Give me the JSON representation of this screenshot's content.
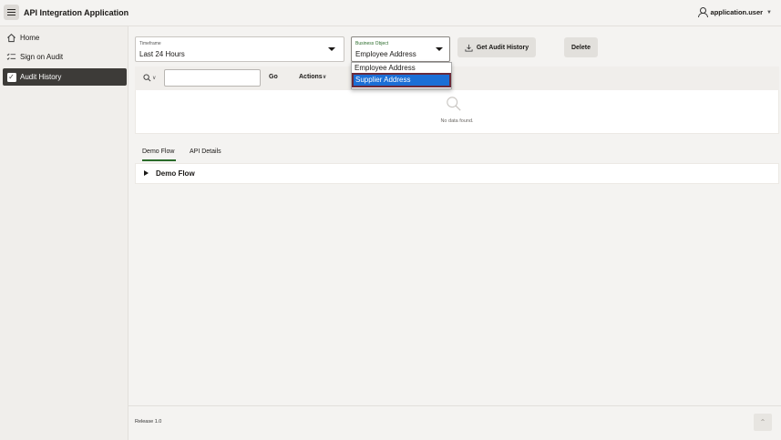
{
  "header": {
    "app_title": "API Integration Application",
    "user_name": "application.user",
    "menu_icon": "hamburger-icon",
    "user_icon": "user-icon"
  },
  "sidebar": {
    "items": [
      {
        "label": "Home",
        "icon": "home-icon",
        "active": false
      },
      {
        "label": "Sign on Audit",
        "icon": "checklist-icon",
        "active": false
      },
      {
        "label": "Audit History",
        "icon": "checkbox-icon",
        "active": true
      }
    ]
  },
  "filters": {
    "timeframe": {
      "label": "Timeframe",
      "value": "Last 24 Hours"
    },
    "business_object": {
      "label": "Business Object",
      "value": "Employee Address",
      "options": [
        "Employee Address",
        "Supplier Address"
      ],
      "highlighted": "Supplier Address"
    }
  },
  "buttons": {
    "get_audit_history": "Get Audit History",
    "delete": "Delete"
  },
  "report": {
    "go_label": "Go",
    "actions_label": "Actions",
    "no_data": "No data found."
  },
  "tabs": [
    {
      "label": "Demo Flow",
      "active": true
    },
    {
      "label": "API Details",
      "active": false
    }
  ],
  "flow_region": {
    "title": "Demo Flow"
  },
  "footer": {
    "release": "Release 1.0"
  },
  "colors": {
    "accent_dark": "#3d3b38",
    "selected_option": "#1c6fd6",
    "tab_underline": "#2a6b2a"
  }
}
